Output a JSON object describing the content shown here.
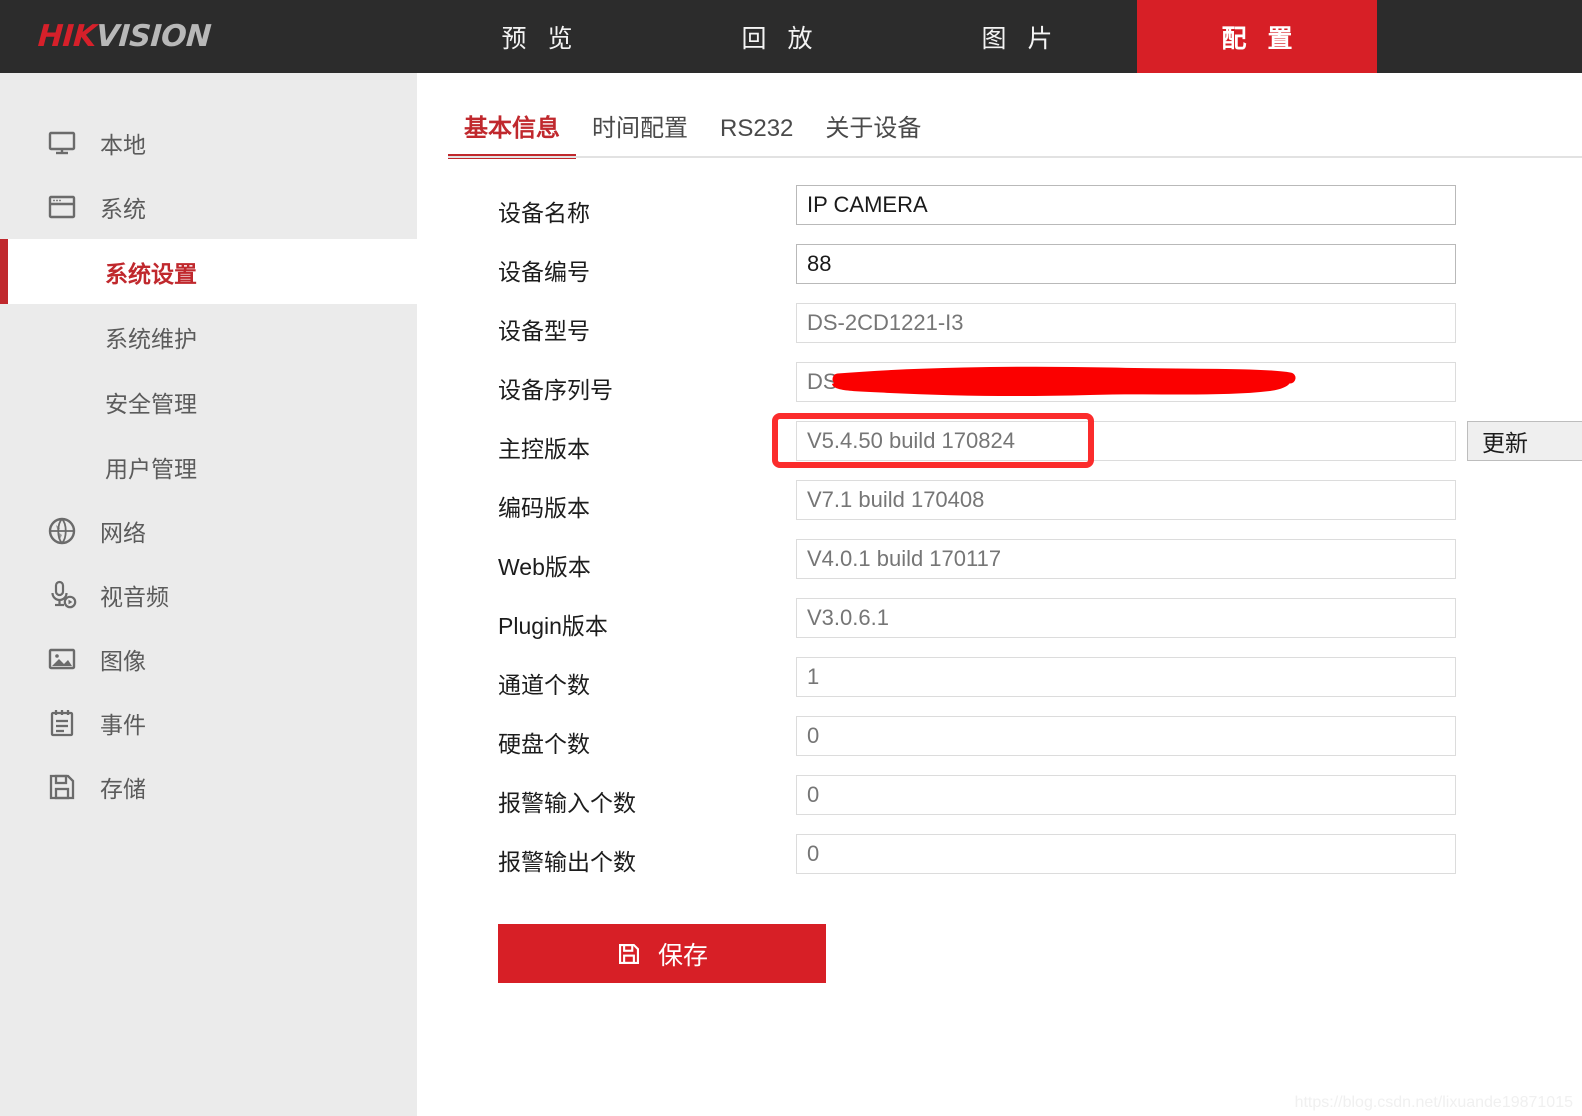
{
  "brand": {
    "logo_hik": "HIK",
    "logo_vision": "VISION",
    "accent_red": "#d71f26",
    "header_bg": "#2c2c2c",
    "sidebar_bg": "#ebebeb",
    "active_text_red": "#c0282d"
  },
  "topnav": {
    "items": [
      {
        "label": "预 览",
        "active": false
      },
      {
        "label": "回 放",
        "active": false
      },
      {
        "label": "图 片",
        "active": false
      },
      {
        "label": "配 置",
        "active": true
      }
    ]
  },
  "sidebar": {
    "groups": [
      {
        "icon": "monitor-icon",
        "label": "本地"
      },
      {
        "icon": "window-icon",
        "label": "系统"
      }
    ],
    "subitems": [
      {
        "label": "系统设置",
        "active": true
      },
      {
        "label": "系统维护",
        "active": false
      },
      {
        "label": "安全管理",
        "active": false
      },
      {
        "label": "用户管理",
        "active": false
      }
    ],
    "groups2": [
      {
        "icon": "globe-icon",
        "label": "网络"
      },
      {
        "icon": "microphone-play-icon",
        "label": "视音频"
      },
      {
        "icon": "image-icon",
        "label": "图像"
      },
      {
        "icon": "notepad-icon",
        "label": "事件"
      },
      {
        "icon": "floppy-disk-icon",
        "label": "存储"
      }
    ]
  },
  "tabs": [
    {
      "label": "基本信息",
      "active": true
    },
    {
      "label": "时间配置",
      "active": false
    },
    {
      "label": "RS232",
      "active": false
    },
    {
      "label": "关于设备",
      "active": false
    }
  ],
  "form": {
    "fields": [
      {
        "label": "设备名称",
        "value": "IP CAMERA",
        "editable": true,
        "annotated": false,
        "redacted": false,
        "has_update": false
      },
      {
        "label": "设备编号",
        "value": "88",
        "editable": true,
        "annotated": false,
        "redacted": false,
        "has_update": false
      },
      {
        "label": "设备型号",
        "value": "DS-2CD1221-I3",
        "editable": false,
        "annotated": false,
        "redacted": false,
        "has_update": false
      },
      {
        "label": "设备序列号",
        "value": "DS-2CD1221-I",
        "editable": false,
        "annotated": false,
        "redacted": true,
        "has_update": false
      },
      {
        "label": "主控版本",
        "value": "V5.4.50 build 170824",
        "editable": false,
        "annotated": true,
        "redacted": false,
        "has_update": true
      },
      {
        "label": "编码版本",
        "value": "V7.1 build 170408",
        "editable": false,
        "annotated": false,
        "redacted": false,
        "has_update": false
      },
      {
        "label": "Web版本",
        "value": "V4.0.1 build 170117",
        "editable": false,
        "annotated": false,
        "redacted": false,
        "has_update": false
      },
      {
        "label": "Plugin版本",
        "value": "V3.0.6.1",
        "editable": false,
        "annotated": false,
        "redacted": false,
        "has_update": false
      },
      {
        "label": "通道个数",
        "value": "1",
        "editable": false,
        "annotated": false,
        "redacted": false,
        "has_update": false
      },
      {
        "label": "硬盘个数",
        "value": "0",
        "editable": false,
        "annotated": false,
        "redacted": false,
        "has_update": false
      },
      {
        "label": "报警输入个数",
        "value": "0",
        "editable": false,
        "annotated": false,
        "redacted": false,
        "has_update": false
      },
      {
        "label": "报警输出个数",
        "value": "0",
        "editable": false,
        "annotated": false,
        "redacted": false,
        "has_update": false
      }
    ],
    "update_label": "更新",
    "save_label": "保存",
    "save_icon": "floppy-disk-icon"
  },
  "watermark": "https://blog.csdn.net/lixuande19871015"
}
